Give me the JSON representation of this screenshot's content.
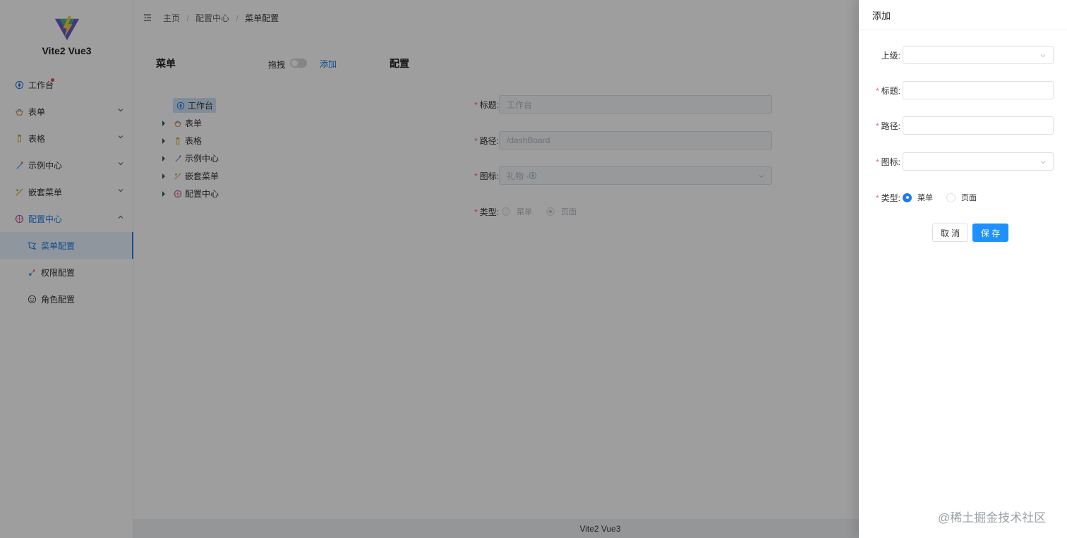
{
  "app": {
    "name": "Vite2 Vue3"
  },
  "sidebar": {
    "items": [
      {
        "label": "工作台",
        "icon": "dashboard-icon"
      },
      {
        "label": "表单",
        "icon": "form-icon"
      },
      {
        "label": "表格",
        "icon": "table-icon"
      },
      {
        "label": "示例中心",
        "icon": "example-icon"
      },
      {
        "label": "嵌套菜单",
        "icon": "nested-icon"
      },
      {
        "label": "配置中心",
        "icon": "config-icon"
      }
    ],
    "subitems": [
      {
        "label": "菜单配置",
        "icon": "menu-config-icon"
      },
      {
        "label": "权限配置",
        "icon": "permission-icon"
      },
      {
        "label": "角色配置",
        "icon": "role-icon"
      }
    ]
  },
  "breadcrumb": {
    "items": [
      "主页",
      "配置中心",
      "菜单配置"
    ],
    "separator": "/"
  },
  "menu_panel": {
    "title": "菜单",
    "drag_label": "拖拽",
    "add_label": "添加",
    "tree": [
      "工作台",
      "表单",
      "表格",
      "示例中心",
      "嵌套菜单",
      "配置中心"
    ]
  },
  "config_panel": {
    "title": "配置",
    "title_label": "标题:",
    "title_value": "工作台",
    "path_label": "路径:",
    "path_value": "/dashBoard",
    "icon_label": "图标:",
    "icon_value": "礼物 - ",
    "type_label": "类型:",
    "type_options": [
      "菜单",
      "页面"
    ],
    "type_selected": "页面"
  },
  "footer": {
    "text": "Vite2 Vue3"
  },
  "drawer": {
    "title": "添加",
    "parent_label": "上级:",
    "title_label": "标题:",
    "path_label": "路径:",
    "icon_label": "图标:",
    "type_label": "类型:",
    "type_options": [
      "菜单",
      "页面"
    ],
    "type_selected": "菜单",
    "cancel_label": "取 消",
    "save_label": "保 存"
  },
  "watermark": "@稀土掘金技术社区",
  "colors": {
    "accent": "#1e7ee8",
    "primary_button": "#1e90ff",
    "required": "#f56c6c"
  }
}
